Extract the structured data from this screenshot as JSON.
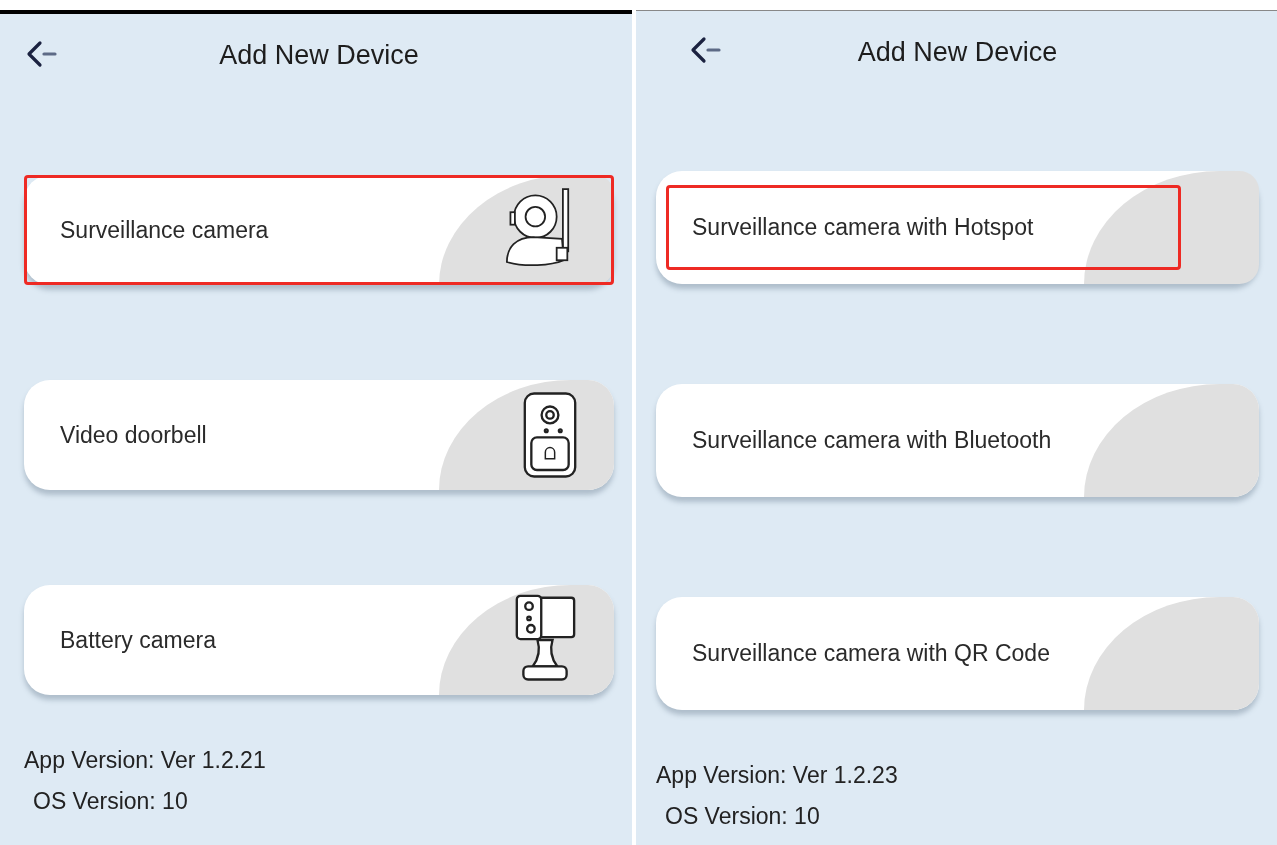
{
  "panels": [
    {
      "title": "Add New Device",
      "devices": [
        {
          "label": "Surveillance camera",
          "kind": "ptz",
          "highlighted": true
        },
        {
          "label": "Video doorbell",
          "kind": "doorbell",
          "highlighted": false
        },
        {
          "label": "Battery camera",
          "kind": "battery",
          "highlighted": false
        }
      ],
      "app_version": "App Version: Ver 1.2.21",
      "os_version": "OS Version: 10"
    },
    {
      "title": "Add New Device",
      "devices": [
        {
          "label": "Surveillance camera with Hotspot",
          "kind": "plain",
          "highlighted": true
        },
        {
          "label": "Surveillance camera with Bluetooth",
          "kind": "plain",
          "highlighted": false
        },
        {
          "label": "Surveillance camera with QR Code",
          "kind": "plain",
          "highlighted": false
        }
      ],
      "app_version": "App Version: Ver 1.2.23",
      "os_version": "OS Version: 10"
    }
  ]
}
